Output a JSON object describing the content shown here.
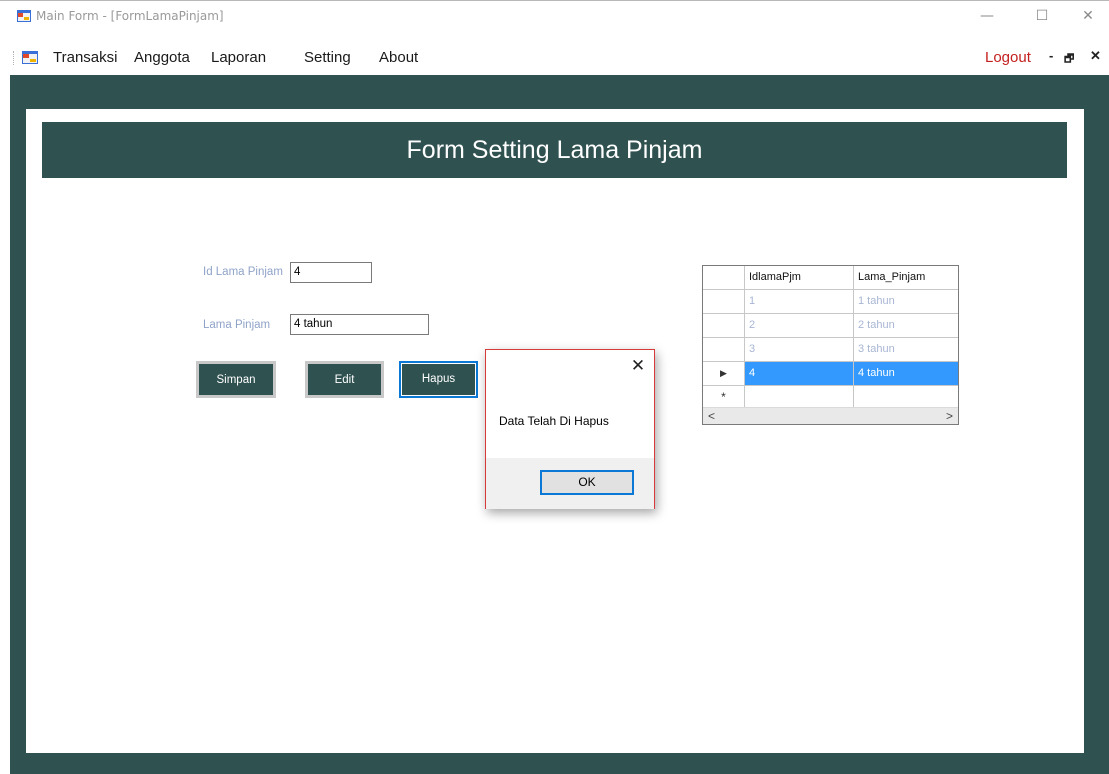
{
  "window": {
    "title": "Main Form - [FormLamaPinjam]",
    "minimize_glyph": "—",
    "maximize_glyph": "☐",
    "close_glyph": "✕"
  },
  "menu": {
    "items": [
      {
        "label": "Transaksi"
      },
      {
        "label": "Anggota"
      },
      {
        "label": "Laporan"
      },
      {
        "label": "Setting"
      },
      {
        "label": "About"
      }
    ],
    "logout_label": "Logout",
    "mdi_minimize": "-",
    "mdi_restore": "🗗",
    "mdi_close": "✕"
  },
  "form": {
    "header_title": "Form Setting Lama Pinjam",
    "id_label": "Id Lama Pinjam",
    "id_value": "4",
    "lama_label": "Lama Pinjam",
    "lama_value": "4 tahun",
    "buttons": {
      "simpan": "Simpan",
      "edit": "Edit",
      "hapus": "Hapus"
    }
  },
  "grid": {
    "columns": [
      "IdlamaPjm",
      "Lama_Pinjam"
    ],
    "rows": [
      {
        "id": "1",
        "lama": "1 tahun"
      },
      {
        "id": "2",
        "lama": "2 tahun"
      },
      {
        "id": "3",
        "lama": "3 tahun"
      },
      {
        "id": "4",
        "lama": "4 tahun"
      }
    ],
    "selected_row_marker": "▶",
    "new_row_marker": "*",
    "scroll_left": "<",
    "scroll_right": ">"
  },
  "message_box": {
    "text": "Data Telah Di Hapus",
    "ok_label": "OK",
    "close_glyph": "✕"
  },
  "colors": {
    "theme_dark_teal": "#2f5150",
    "selection_blue": "#3399ff",
    "logout_red": "#c41f1f"
  }
}
